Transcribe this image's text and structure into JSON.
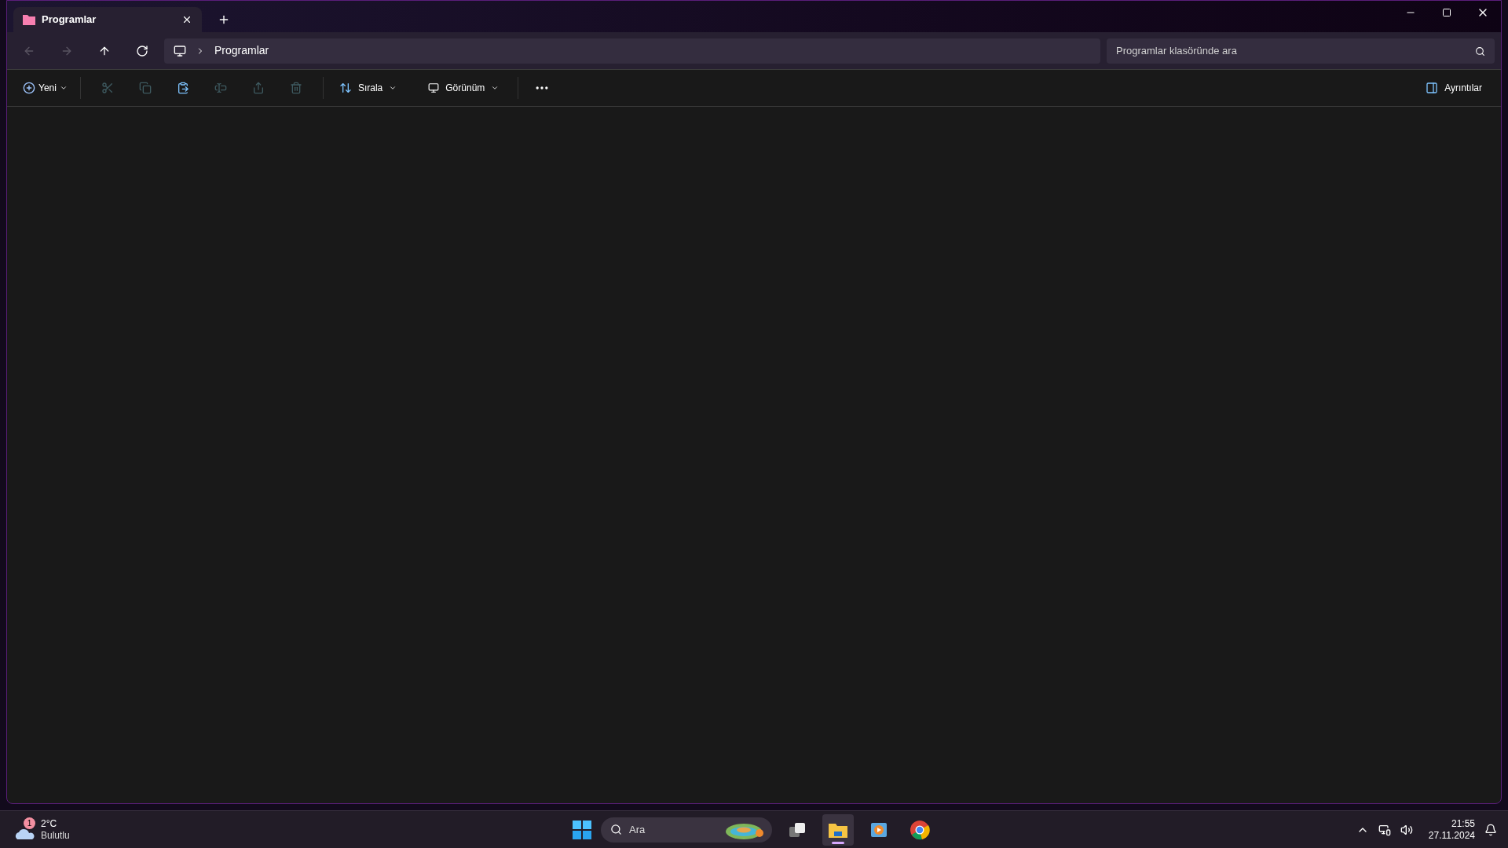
{
  "window": {
    "tab": {
      "title": "Programlar"
    }
  },
  "navigation": {
    "buttons": [
      {
        "kind": "back",
        "disabled": true
      },
      {
        "kind": "forward",
        "disabled": true
      },
      {
        "kind": "up",
        "disabled": false
      },
      {
        "kind": "refresh",
        "disabled": false
      }
    ],
    "breadcrumb": [
      "Programlar"
    ],
    "search": {
      "placeholder": "Programlar klasöründe ara"
    }
  },
  "toolbar": {
    "new": {
      "label": "Yeni"
    },
    "actions": [
      {
        "kind": "cut",
        "disabled": true
      },
      {
        "kind": "copy",
        "disabled": true
      },
      {
        "kind": "paste",
        "disabled": false
      },
      {
        "kind": "rename",
        "disabled": true
      },
      {
        "kind": "share",
        "disabled": true
      },
      {
        "kind": "delete",
        "disabled": true
      }
    ],
    "sort": {
      "label": "Sırala"
    },
    "view": {
      "label": "Görünüm"
    },
    "details": {
      "label": "Ayrıntılar"
    }
  },
  "taskbar": {
    "weather": {
      "badge": "1",
      "temperature": "2°C",
      "condition": "Bulutlu"
    },
    "search": {
      "placeholder": "Ara"
    },
    "apps": [
      {
        "kind": "taskview",
        "selected": false
      },
      {
        "kind": "explorer",
        "selected": true
      },
      {
        "kind": "media",
        "selected": false
      },
      {
        "kind": "browser",
        "selected": false
      }
    ],
    "clock": {
      "time": "21:55",
      "date": "27.11.2024"
    }
  }
}
